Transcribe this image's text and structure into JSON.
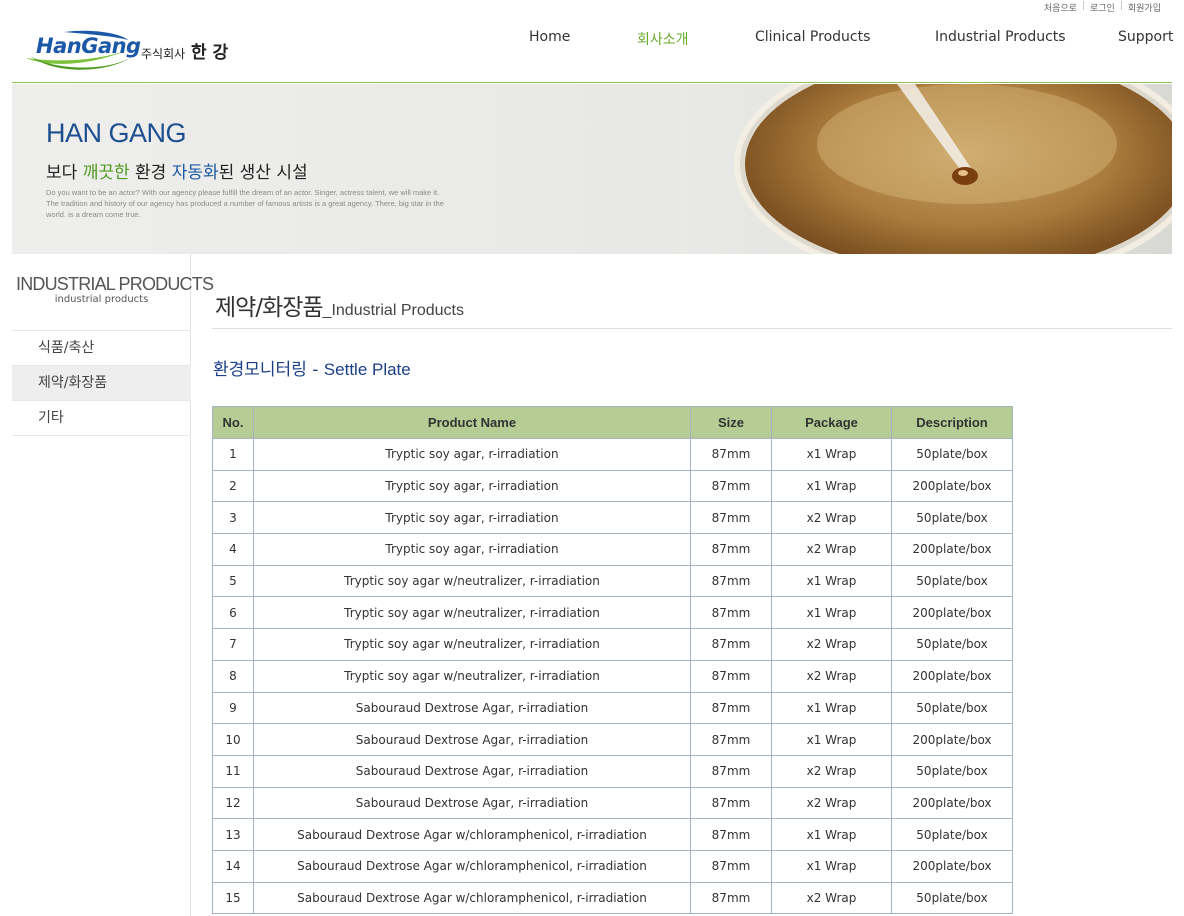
{
  "util_links": [
    "처음으로",
    "로그인",
    "회원가입"
  ],
  "logo": {
    "brand_part1": "Han",
    "brand_part2": "Gang",
    "corp_prefix": "주식회사",
    "corp_name": "한 강"
  },
  "nav": [
    {
      "label": "Home",
      "active": false
    },
    {
      "label": "회사소개",
      "active": true
    },
    {
      "label": "Clinical Products",
      "active": false
    },
    {
      "label": "Industrial Products",
      "active": false
    },
    {
      "label": "Support",
      "active": false
    }
  ],
  "banner": {
    "title": "HAN GANG",
    "sub_1": "보다 ",
    "sub_2": "깨끗한",
    "sub_3": " 환경 ",
    "sub_4": "자동화",
    "sub_5": "된 생산 시설",
    "desc": "Do you want to be an actor? With our agency please fulfill the dream of an actor. Singer, actress talent, we will make it. The tradition and history of our agency has produced a number of famous artists is a great agency. There, big star in the world. is a dream come true."
  },
  "sidebar": {
    "title": "INDUSTRIAL PRODUCTS",
    "subtitle": "industrial products",
    "items": [
      {
        "label": "식품/축산",
        "active": false
      },
      {
        "label": "제약/화장품",
        "active": true
      },
      {
        "label": "기타",
        "active": false
      }
    ]
  },
  "content": {
    "heading_ko": "제약/화장품",
    "heading_en": "_Industrial Products",
    "subheading_ko": "환경모니터링 - ",
    "subheading_en": "Settle Plate"
  },
  "table": {
    "headers": [
      "No.",
      "Product Name",
      "Size",
      "Package",
      "Description"
    ],
    "rows": [
      [
        "1",
        "Tryptic soy agar, r-irradiation",
        "87mm",
        "x1 Wrap",
        "50plate/box"
      ],
      [
        "2",
        "Tryptic soy agar, r-irradiation",
        "87mm",
        "x1 Wrap",
        "200plate/box"
      ],
      [
        "3",
        "Tryptic soy agar, r-irradiation",
        "87mm",
        "x2 Wrap",
        "50plate/box"
      ],
      [
        "4",
        "Tryptic soy agar, r-irradiation",
        "87mm",
        "x2 Wrap",
        "200plate/box"
      ],
      [
        "5",
        "Tryptic soy agar w/neutralizer, r-irradiation",
        "87mm",
        "x1 Wrap",
        "50plate/box"
      ],
      [
        "6",
        "Tryptic soy agar w/neutralizer, r-irradiation",
        "87mm",
        "x1 Wrap",
        "200plate/box"
      ],
      [
        "7",
        "Tryptic soy agar w/neutralizer, r-irradiation",
        "87mm",
        "x2 Wrap",
        "50plate/box"
      ],
      [
        "8",
        "Tryptic soy agar w/neutralizer, r-irradiation",
        "87mm",
        "x2 Wrap",
        "200plate/box"
      ],
      [
        "9",
        "Sabouraud Dextrose Agar, r-irradiation",
        "87mm",
        "x1 Wrap",
        "50plate/box"
      ],
      [
        "10",
        "Sabouraud Dextrose Agar, r-irradiation",
        "87mm",
        "x1 Wrap",
        "200plate/box"
      ],
      [
        "11",
        "Sabouraud Dextrose Agar, r-irradiation",
        "87mm",
        "x2 Wrap",
        "50plate/box"
      ],
      [
        "12",
        "Sabouraud Dextrose Agar, r-irradiation",
        "87mm",
        "x2 Wrap",
        "200plate/box"
      ],
      [
        "13",
        "Sabouraud Dextrose Agar w/chloramphenicol, r-irradiation",
        "87mm",
        "x1 Wrap",
        "50plate/box"
      ],
      [
        "14",
        "Sabouraud Dextrose Agar w/chloramphenicol, r-irradiation",
        "87mm",
        "x1 Wrap",
        "200plate/box"
      ],
      [
        "15",
        "Sabouraud Dextrose Agar w/chloramphenicol, r-irradiation",
        "87mm",
        "x2 Wrap",
        "50plate/box"
      ]
    ]
  },
  "colors": {
    "accent_green": "#6aaa2a",
    "header_green": "#b5cc95",
    "title_blue": "#1d4f8f",
    "subhead_blue": "#1c3f86"
  }
}
